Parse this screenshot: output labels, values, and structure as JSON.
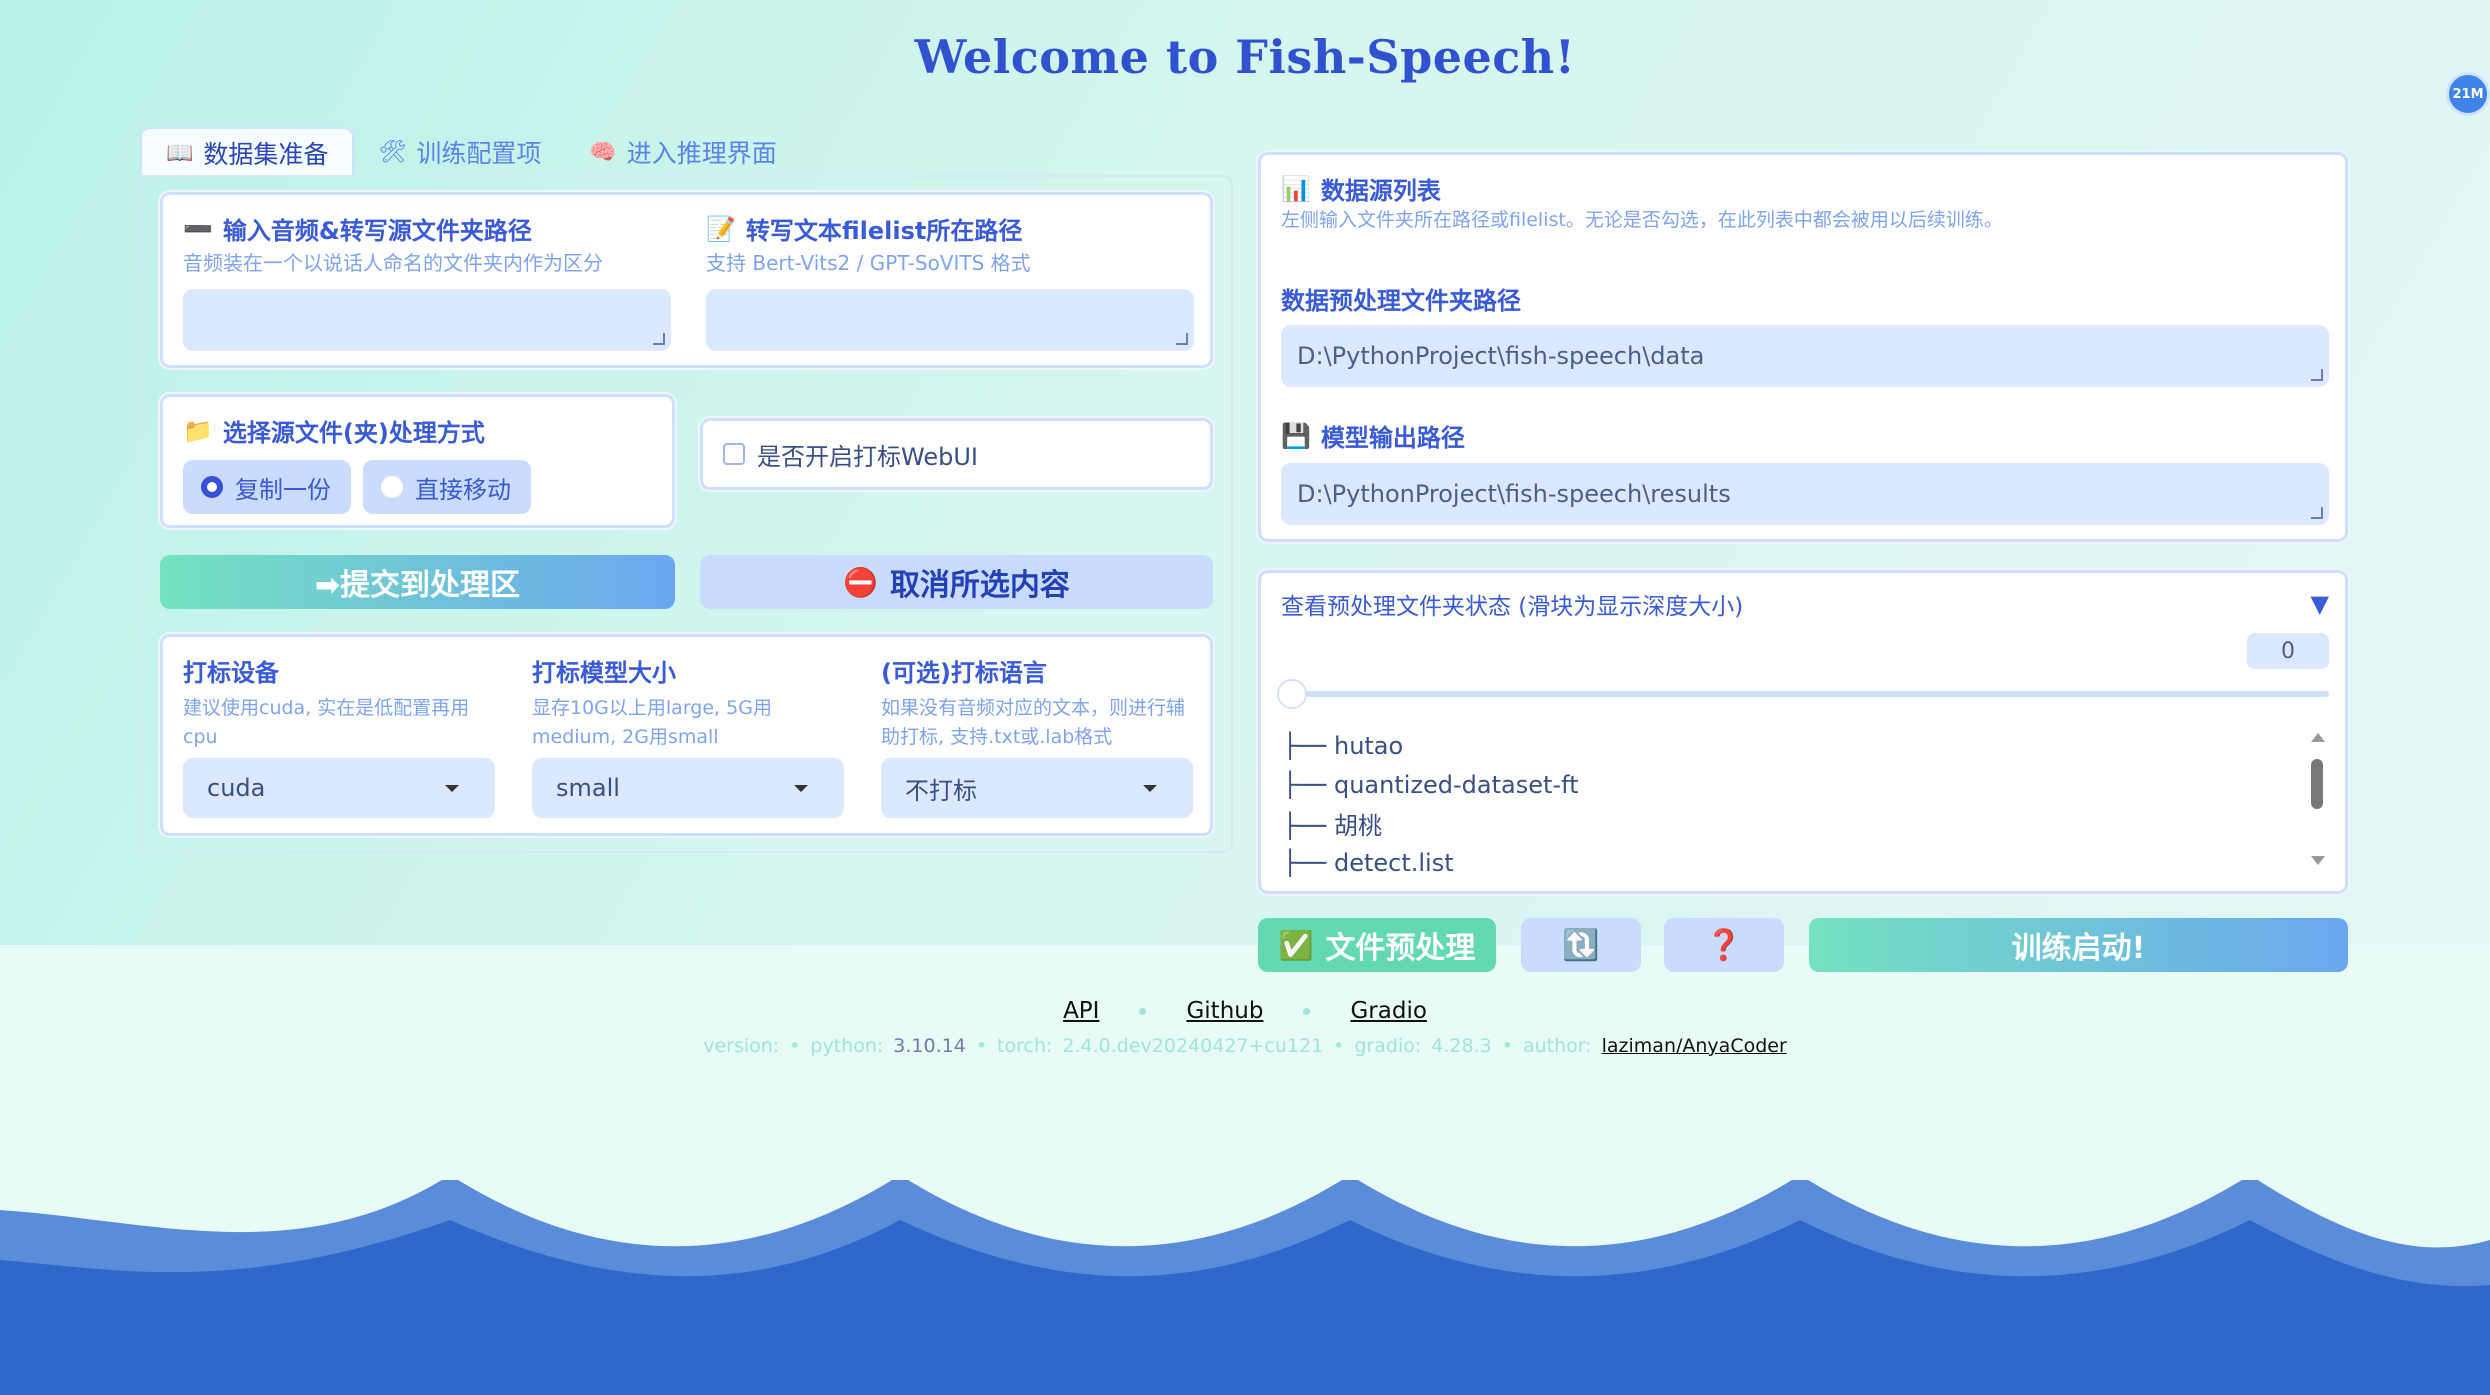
{
  "title": "Welcome to Fish-Speech!",
  "badge": "21M",
  "tabs": [
    {
      "icon": "📖",
      "label": "数据集准备"
    },
    {
      "icon": "🛠",
      "label": "训练配置项"
    },
    {
      "icon": "🧠",
      "label": "进入推理界面"
    }
  ],
  "input_audio": {
    "icon": "➖",
    "label": "输入音频&转写源文件夹路径",
    "sub": "音频装在一个以说话人命名的文件夹内作为区分",
    "value": ""
  },
  "filelist": {
    "icon": "📝",
    "label": "转写文本filelist所在路径",
    "sub": "支持 Bert-Vits2 / GPT-SoVITS 格式",
    "value": ""
  },
  "source_mode": {
    "icon": "📁",
    "label": "选择源文件(夹)处理方式",
    "options": [
      "复制一份",
      "直接移动"
    ],
    "selected": "复制一份"
  },
  "webui_checkbox": {
    "label": "是否开启打标WebUI",
    "checked": false
  },
  "buttons": {
    "submit": "➡提交到处理区",
    "cancel_icon": "⛔",
    "cancel": "取消所选内容",
    "preprocess_icon": "✅",
    "preprocess": "文件预处理",
    "refresh": "🔃",
    "help": "❓",
    "train": "训练启动!"
  },
  "label_device": {
    "label": "打标设备",
    "sub": "建议使用cuda, 实在是低配置再用cpu",
    "value": "cuda"
  },
  "label_model": {
    "label": "打标模型大小",
    "sub": "显存10G以上用large, 5G用medium, 2G用small",
    "value": "small"
  },
  "label_lang": {
    "label": "(可选)打标语言",
    "sub": "如果没有音频对应的文本，则进行辅助打标, 支持.txt或.lab格式",
    "value": "不打标"
  },
  "data_source": {
    "icon": "📊",
    "label": "数据源列表",
    "sub": "左侧输入文件夹所在路径或filelist。无论是否勾选，在此列表中都会被用以后续训练。"
  },
  "preprocess_path": {
    "label": "数据预处理文件夹路径",
    "value": "D:\\PythonProject\\fish-speech\\data"
  },
  "output_path": {
    "icon": "💾",
    "label": "模型输出路径",
    "value": "D:\\PythonProject\\fish-speech\\results"
  },
  "status_panel": {
    "label": "查看预处理文件夹状态 (滑块为显示深度大小)",
    "toggle": "▼",
    "slider_value": "0",
    "slider_fraction": 0,
    "tree": [
      "├── hutao",
      "├── quantized-dataset-ft",
      "├── 胡桃",
      "├── detect.list"
    ]
  },
  "footer": {
    "links": [
      "API",
      "Github",
      "Gradio"
    ],
    "version_label": "version:",
    "python_label": "python:",
    "python_value": "3.10.14",
    "torch_label": "torch:",
    "torch_value": "2.4.0.dev20240427+cu121",
    "gradio_label": "gradio:",
    "gradio_value": "4.28.3",
    "author_label": "author:",
    "author_value": "laziman/AnyaCoder"
  },
  "colors": {
    "accent": "#3a5bd8",
    "panel_border": "#cfe0ff",
    "input_bg": "#dbe8ff",
    "wave_dark": "#2f69cc",
    "wave_light": "#5d8fdb"
  }
}
